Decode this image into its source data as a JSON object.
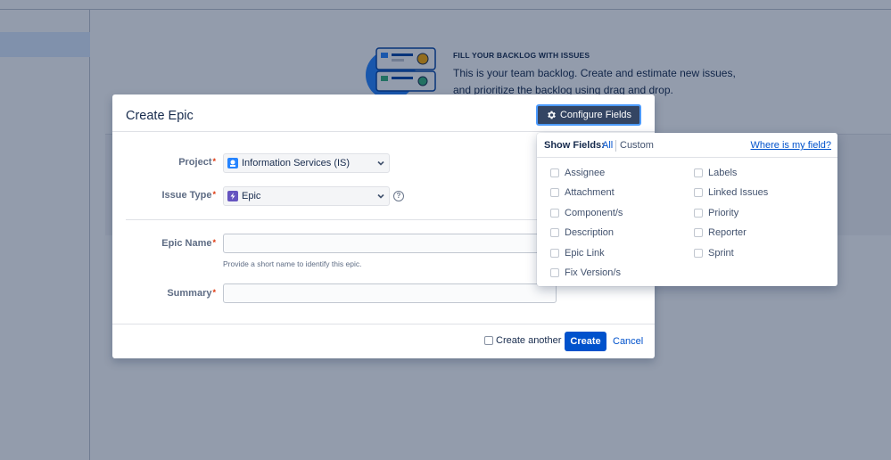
{
  "background": {
    "cta_title": "FILL YOUR BACKLOG WITH ISSUES",
    "cta_line1": "This is your team backlog. Create and estimate new issues,",
    "cta_line2": "and prioritize the backlog using drag and drop."
  },
  "dialog": {
    "title": "Create Epic",
    "configure_fields_label": "Configure Fields",
    "fields": {
      "project": {
        "label": "Project",
        "value": "Information Services (IS)"
      },
      "issue_type": {
        "label": "Issue Type",
        "value": "Epic"
      },
      "epic_name": {
        "label": "Epic Name",
        "value": "",
        "helper": "Provide a short name to identify this epic."
      },
      "summary": {
        "label": "Summary",
        "value": ""
      }
    },
    "required_mark": "*",
    "help_glyph": "?",
    "footer": {
      "create_another": "Create another",
      "create": "Create",
      "cancel": "Cancel"
    }
  },
  "configure_dropdown": {
    "show_fields_label": "Show Fields:",
    "all_label": "All",
    "custom_label": "Custom",
    "where_link": "Where is my field?",
    "options_left": [
      "Assignee",
      "Attachment",
      "Component/s",
      "Description",
      "Epic Link",
      "Fix Version/s"
    ],
    "options_right": [
      "Labels",
      "Linked Issues",
      "Priority",
      "Reporter",
      "Sprint"
    ]
  },
  "colors": {
    "primary": "#0052cc",
    "configure_button_bg": "#344563",
    "configure_button_focus": "#4c9aff",
    "required": "#de350b",
    "epic_icon": "#6554c0",
    "overlay": "rgba(9, 30, 66, 0.44)"
  },
  "icons": {
    "configure": "gear-icon",
    "project": "project-avatar-icon",
    "issue_type": "epic-lightning-icon",
    "select_chevron": "chevron-down-icon",
    "help": "help-icon"
  }
}
